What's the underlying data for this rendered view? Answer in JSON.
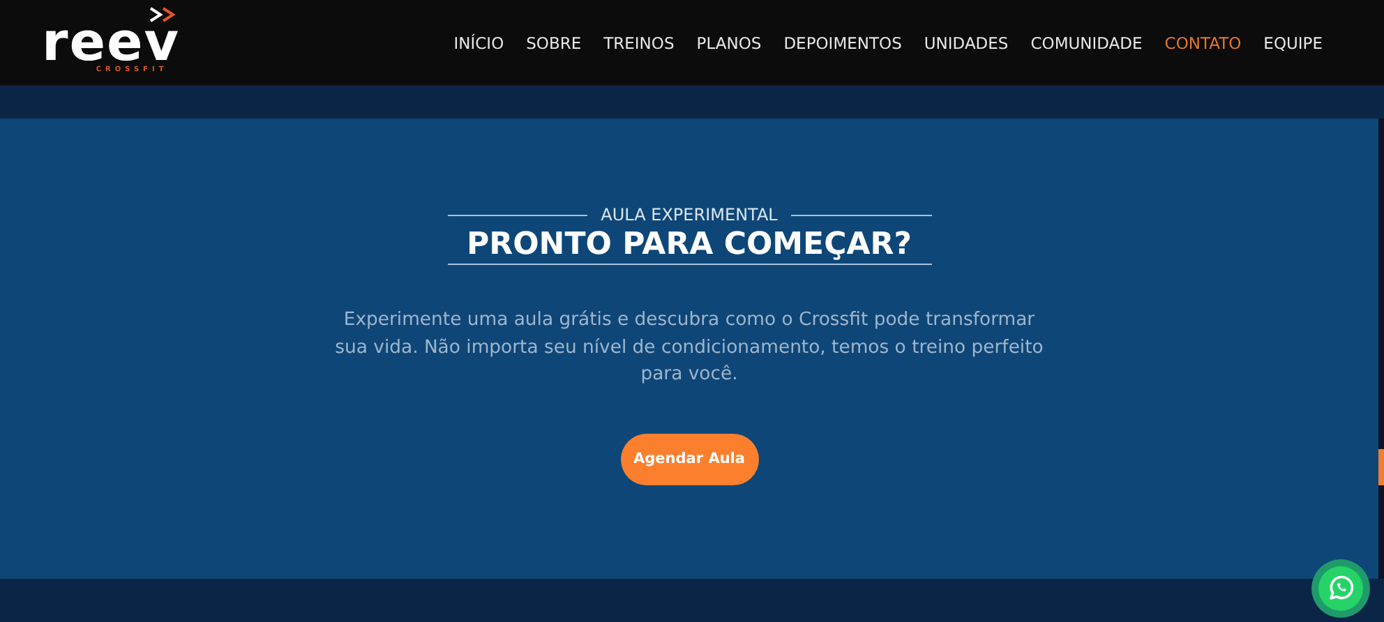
{
  "header": {
    "logo": {
      "wordmark": "reev",
      "tagline": "CROSSFIT"
    },
    "nav": [
      {
        "label": "INÍCIO",
        "selected": false
      },
      {
        "label": "SOBRE",
        "selected": false
      },
      {
        "label": "TREINOS",
        "selected": false
      },
      {
        "label": "PLANOS",
        "selected": false
      },
      {
        "label": "DEPOIMENTOS",
        "selected": false
      },
      {
        "label": "UNIDADES",
        "selected": false
      },
      {
        "label": "COMUNIDADE",
        "selected": false
      },
      {
        "label": "CONTATO",
        "selected": true
      },
      {
        "label": "EQUIPE",
        "selected": false
      }
    ]
  },
  "cta": {
    "eyebrow": "AULA EXPERIMENTAL",
    "title": "PRONTO PARA COMEÇAR?",
    "text": "Experimente uma aula grátis e descubra como o Crossfit pode transformar sua vida. Não importa seu nível de condicionamento, temos o treino perfeito para você.",
    "button": "Agendar Aula"
  }
}
